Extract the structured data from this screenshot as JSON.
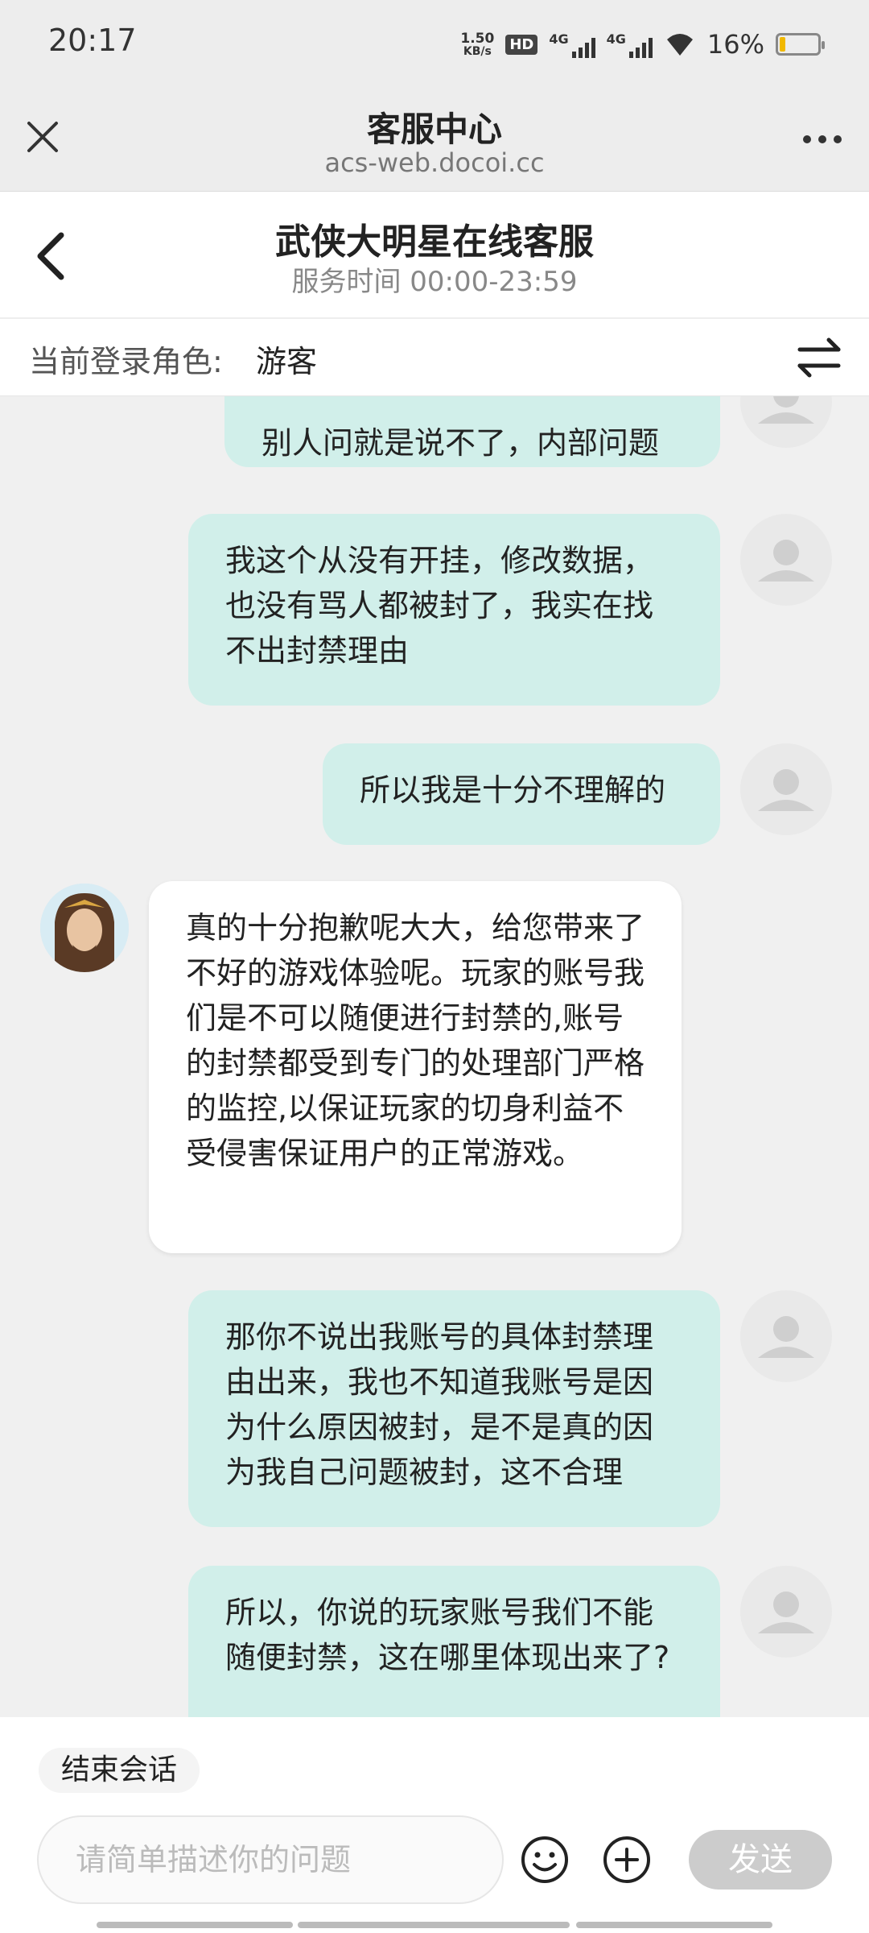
{
  "status_bar": {
    "time": "20:17",
    "net_speed_value": "1.50",
    "net_speed_unit": "KB/s",
    "hd_label": "HD",
    "net1_label": "4G",
    "net2_label": "4G",
    "battery_percent": "16%",
    "battery_level": 0.16,
    "battery_color": "#f1b800"
  },
  "webview": {
    "title": "客服中心",
    "url": "acs-web.docoi.cc"
  },
  "service": {
    "title": "武侠大明星在线客服",
    "hours": "服务时间 00:00-23:59"
  },
  "role": {
    "label": "当前登录角色:",
    "value": "游客"
  },
  "messages": [
    {
      "from": "user",
      "text": "别人问就是说不了，内部问题"
    },
    {
      "from": "user",
      "text": "我这个从没有开挂，修改数据，也没有骂人都被封了，我实在找不出封禁理由"
    },
    {
      "from": "user",
      "text": "所以我是十分不理解的"
    },
    {
      "from": "agent",
      "text": "真的十分抱歉呢大大，给您带来了不好的游戏体验呢。玩家的账号我们是不可以随便进行封禁的,账号的封禁都受到专门的处理部门严格的监控,以保证玩家的切身利益不受侵害保证用户的正常游戏。"
    },
    {
      "from": "user",
      "text": "那你不说出我账号的具体封禁理由出来，我也不知道我账号是因为什么原因被封，是不是真的因为我自己问题被封，这不合理"
    },
    {
      "from": "user",
      "text": "所以，你说的玩家账号我们不能随便封禁，这在哪里体现出来了?"
    }
  ],
  "bottom": {
    "end_session_label": "结束会话",
    "input_placeholder": "请简单描述你的问题",
    "send_label": "发送"
  },
  "colors": {
    "user_bubble": "#d1efea",
    "agent_bubble": "#ffffff",
    "send_disabled": "#cccccc"
  }
}
